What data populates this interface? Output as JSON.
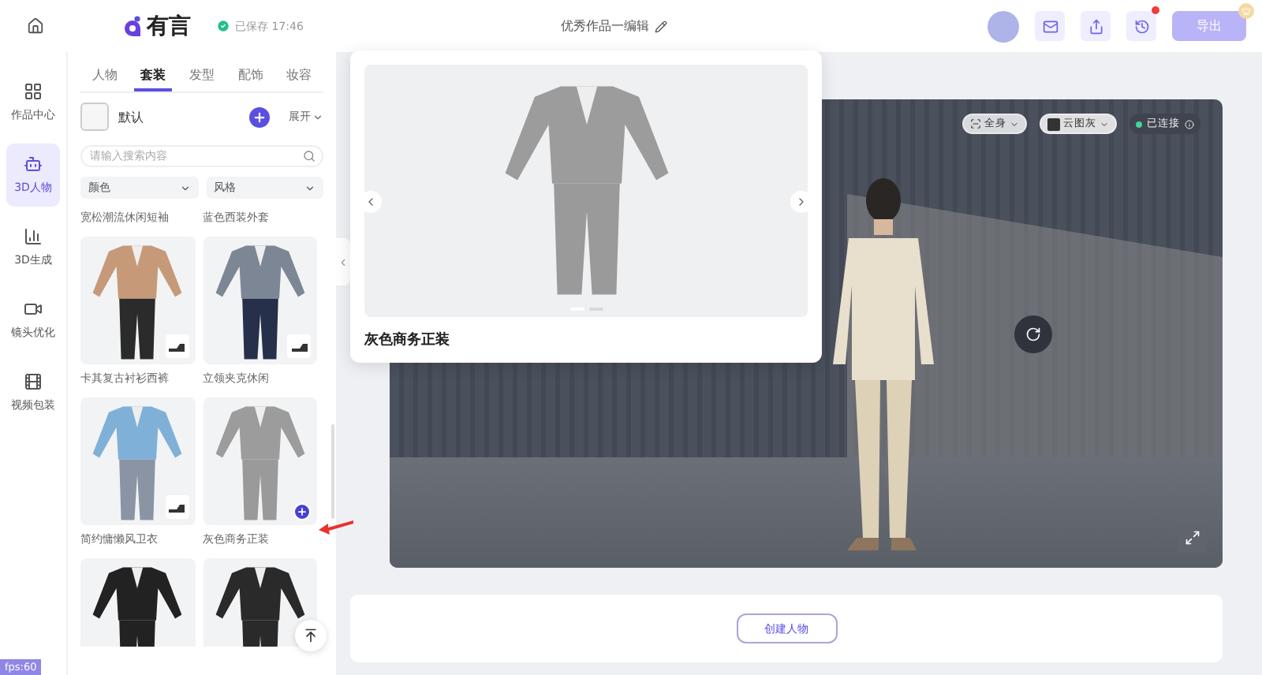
{
  "header": {
    "logo": "有言",
    "save_status": "已保存 17:46",
    "title": "优秀作品一编辑",
    "export_button": "导出",
    "has_notification": true
  },
  "nav": [
    {
      "label": "作品中心",
      "selected": false
    },
    {
      "label": "3D人物",
      "selected": true
    },
    {
      "label": "3D生成",
      "selected": false
    },
    {
      "label": "镜头优化",
      "selected": false
    },
    {
      "label": "视频包装",
      "selected": false
    }
  ],
  "panel": {
    "tabs": [
      {
        "label": "人物",
        "selected": false
      },
      {
        "label": "套装",
        "selected": true
      },
      {
        "label": "发型",
        "selected": false
      },
      {
        "label": "配饰",
        "selected": false
      },
      {
        "label": "妆容",
        "selected": false
      }
    ],
    "default_outfit": "默认",
    "expand": "展开",
    "search": {
      "placeholder": "请输入搜索内容"
    },
    "filters": [
      "颜色",
      "风格"
    ],
    "outfits": [
      {
        "kind": "cut-top",
        "name": "宽松潮流休闲短袖"
      },
      {
        "kind": "cut-top",
        "name": "蓝色西装外套"
      },
      {
        "kind": "card",
        "name": "卡其复古衬衫西裤",
        "add_button": false
      },
      {
        "kind": "card",
        "name": "立领夹克休闲",
        "add_button": false
      },
      {
        "kind": "card",
        "name": "简约慵懒风卫衣",
        "add_button": false
      },
      {
        "kind": "card",
        "name": "灰色商务正装",
        "add_button": true
      },
      {
        "kind": "cut-bottom"
      },
      {
        "kind": "cut-bottom"
      }
    ]
  },
  "preview": {
    "title": "灰色商务正装",
    "slides": [
      {
        "selected": true
      },
      {
        "selected": false
      }
    ]
  },
  "viewer": {
    "view_mode": "全身",
    "background": "云图灰",
    "connection": "已连接",
    "connected": true
  },
  "create_button": "创建人物",
  "fps": "fps:60"
}
